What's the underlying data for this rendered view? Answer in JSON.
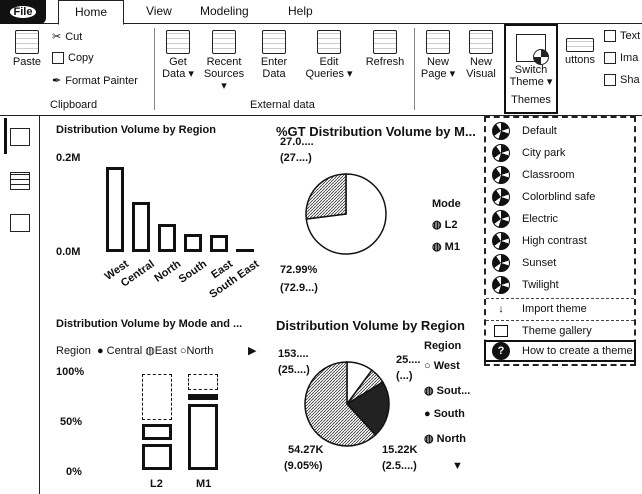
{
  "menubar": {
    "file": "File",
    "tabs": [
      "Home",
      "View",
      "Modeling",
      "Help"
    ]
  },
  "ribbon": {
    "paste": "Paste",
    "cut": "Cut",
    "copy": "Copy",
    "format_painter": "Format Painter",
    "clipboard_group": "Clipboard",
    "get_data": [
      "Get",
      "Data ▾"
    ],
    "recent_sources": [
      "Recent",
      "Sources ▾"
    ],
    "enter_data": [
      "Enter",
      "Data"
    ],
    "edit_queries": [
      "Edit",
      "Queries ▾"
    ],
    "refresh": "Refresh",
    "external_group": "External data",
    "new_page": [
      "New",
      "Page ▾"
    ],
    "new_visual": [
      "New",
      "Visual"
    ],
    "switch_theme": [
      "Switch",
      "Theme ▾"
    ],
    "themes_group": "Themes",
    "buttons": "uttons",
    "text": "Text",
    "image": "Ima",
    "shapes": "Sha"
  },
  "canvas": {
    "chart1": {
      "title": "Distribution Volume by Region",
      "yticks": [
        "0.2M",
        "0.0M"
      ],
      "categories": [
        "West",
        "Central",
        "North",
        "South",
        "East",
        "South East"
      ]
    },
    "chart2": {
      "title": "%GT Distribution Volume by M...",
      "label_top": [
        "27.0....",
        "(27....)"
      ],
      "label_bottom": [
        "72.99%",
        "(72.9...)"
      ],
      "legend_title": "Mode",
      "legend": [
        "L2",
        "M1"
      ]
    },
    "chart3": {
      "title": "Distribution Volume by Mode and ...",
      "legend_title": "Region",
      "legend": [
        "Central",
        "East",
        "North"
      ],
      "more_arrow": "▶",
      "yticks": [
        "100%",
        "50%",
        "0%"
      ],
      "categories": [
        "L2",
        "M1"
      ]
    },
    "chart4": {
      "title": "Distribution Volume by Region",
      "labels": [
        "153....",
        "(25....)",
        "25....",
        "(...)",
        "54.27K",
        "(9.05%)",
        "15.22K",
        "(2.5....)"
      ],
      "legend_title": "Region",
      "legend": [
        "West",
        "Sout...",
        "South",
        "North"
      ],
      "more_arrow": "▼"
    }
  },
  "themes_menu": {
    "items": [
      "Default",
      "City park",
      "Classroom",
      "Colorblind safe",
      "Electric",
      "High contrast",
      "Sunset",
      "Twilight"
    ],
    "import": "Import theme",
    "gallery": "Theme gallery",
    "howto": "How to create a theme"
  },
  "chart_data": [
    {
      "type": "bar",
      "title": "Distribution Volume by Region",
      "categories": [
        "West",
        "Central",
        "North",
        "South",
        "East",
        "South East"
      ],
      "values": [
        0.255,
        0.15,
        0.085,
        0.055,
        0.05,
        0.01
      ],
      "ylim": [
        0,
        0.3
      ],
      "ylabel": ""
    },
    {
      "type": "pie",
      "title": "%GT Distribution Volume by M...",
      "categories": [
        "L2",
        "M1"
      ],
      "values": [
        27.01,
        72.99
      ]
    },
    {
      "type": "bar",
      "title": "Distribution Volume by Mode and ...",
      "categories": [
        "L2",
        "M1"
      ],
      "series": [
        {
          "name": "Central",
          "values": [
            30,
            70
          ]
        },
        {
          "name": "East",
          "values": [
            20,
            10
          ]
        },
        {
          "name": "North",
          "values": [
            50,
            20
          ]
        }
      ],
      "ylim": [
        0,
        100
      ]
    },
    {
      "type": "pie",
      "title": "Distribution Volume by Region",
      "categories": [
        "West",
        "Sout...",
        "South",
        "North"
      ],
      "values": [
        153,
        25,
        54.27,
        15.22
      ]
    }
  ]
}
